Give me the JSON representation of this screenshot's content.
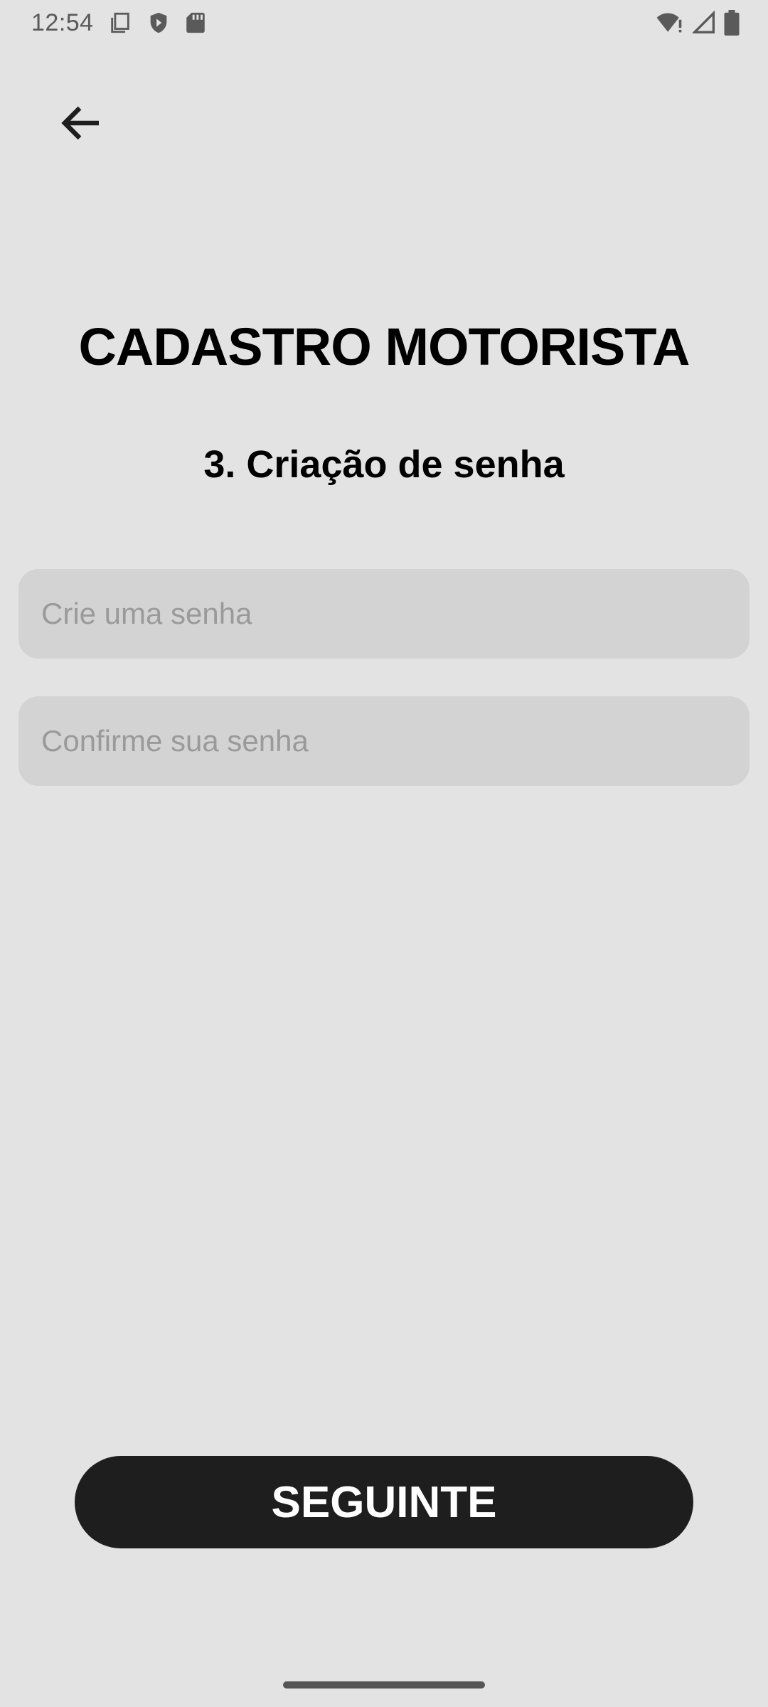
{
  "status_bar": {
    "time": "12:54",
    "left_icons": [
      "copy-icon",
      "shield-play-icon",
      "sd-card-icon"
    ],
    "right_icons": [
      "wifi-alert-icon",
      "signal-icon",
      "battery-icon"
    ]
  },
  "header": {
    "back_icon": "arrow-left-icon"
  },
  "main": {
    "title": "CADASTRO MOTORISTA",
    "step_title": "3. Criação de senha",
    "fields": [
      {
        "placeholder": "Crie uma senha",
        "value": ""
      },
      {
        "placeholder": "Confirme sua senha",
        "value": ""
      }
    ]
  },
  "footer": {
    "next_label": "SEGUINTE"
  },
  "colors": {
    "background": "#e3e3e3",
    "field_bg": "#d3d3d3",
    "button_bg": "#1e1e1e",
    "button_text": "#ffffff"
  }
}
